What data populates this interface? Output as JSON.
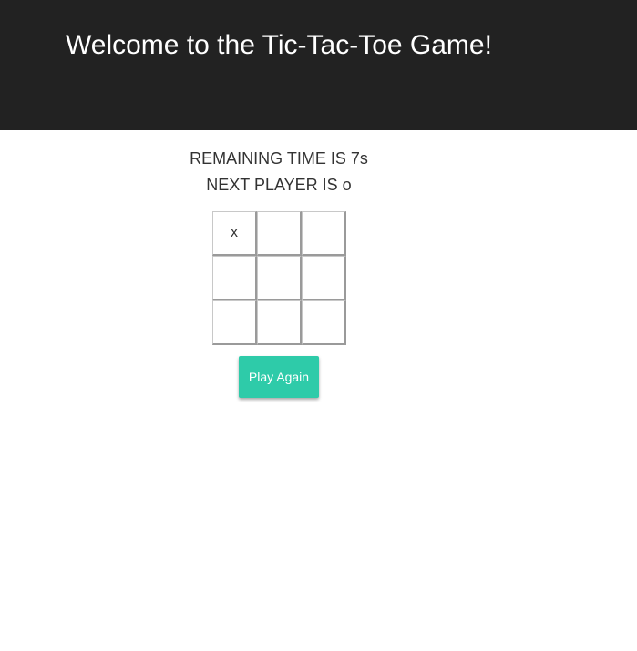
{
  "header": {
    "title": "Welcome to the Tic-Tac-Toe Game!"
  },
  "status": {
    "remaining_time": "REMAINING TIME IS 7s",
    "next_player": "NEXT PLAYER IS o"
  },
  "board": {
    "cells": [
      "x",
      "",
      "",
      "",
      "",
      "",
      "",
      "",
      ""
    ]
  },
  "controls": {
    "play_again_label": "Play Again"
  },
  "colors": {
    "header_background": "#222222",
    "button_accent": "#2ecba9"
  }
}
